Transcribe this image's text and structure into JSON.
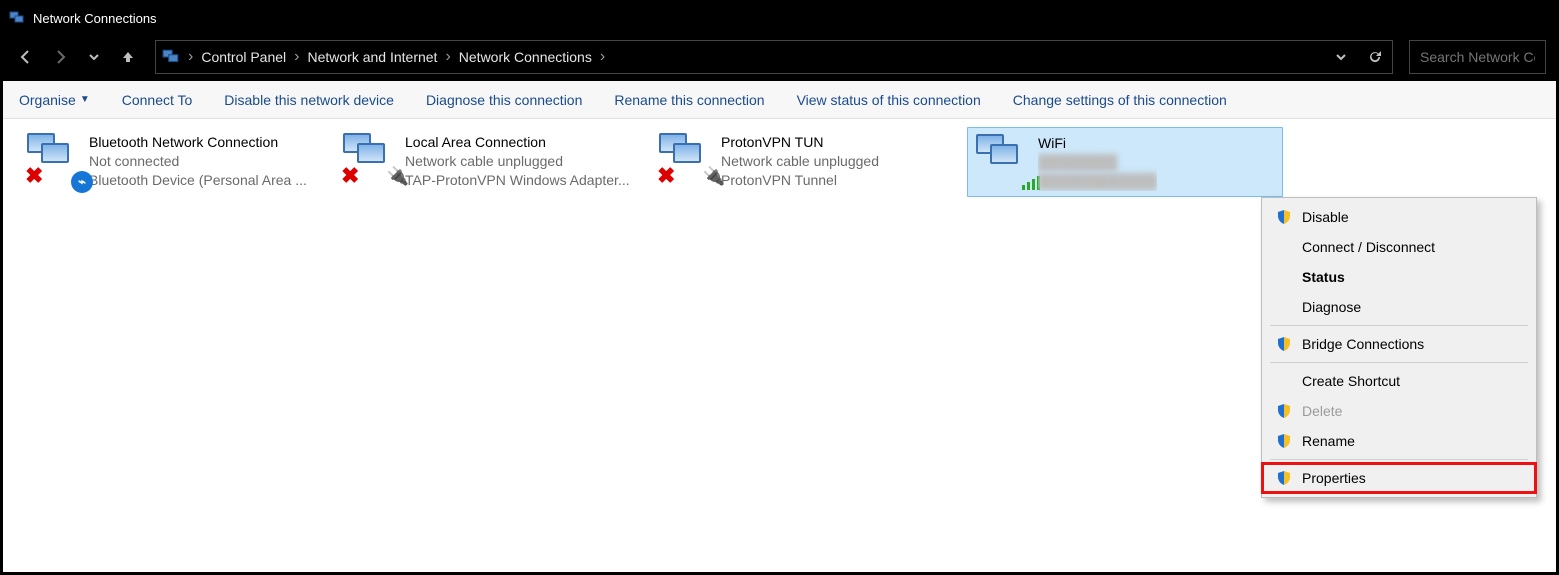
{
  "window": {
    "title": "Network Connections"
  },
  "breadcrumbs": {
    "items": [
      "Control Panel",
      "Network and Internet",
      "Network Connections"
    ]
  },
  "search": {
    "placeholder": "Search Network Conne"
  },
  "toolbar": {
    "organise": "Organise",
    "items": [
      "Connect To",
      "Disable this network device",
      "Diagnose this connection",
      "Rename this connection",
      "View status of this connection",
      "Change settings of this connection"
    ]
  },
  "connections": [
    {
      "name": "Bluetooth Network Connection",
      "status": "Not connected",
      "device": "Bluetooth Device (Personal Area ...",
      "overlay": "bluetooth-x",
      "selected": false
    },
    {
      "name": "Local Area Connection",
      "status": "Network cable unplugged",
      "device": "TAP-ProtonVPN Windows Adapter...",
      "overlay": "plug-x",
      "selected": false
    },
    {
      "name": "ProtonVPN TUN",
      "status": "Network cable unplugged",
      "device": "ProtonVPN Tunnel",
      "overlay": "plug-x",
      "selected": false
    },
    {
      "name": "WiFi",
      "status": "████████",
      "device": "████████████",
      "overlay": "wifi-bars",
      "selected": true
    }
  ],
  "context_menu": {
    "items": [
      {
        "label": "Disable",
        "shield": true,
        "bold": false,
        "disabled": false,
        "highlight": false
      },
      {
        "label": "Connect / Disconnect",
        "shield": false,
        "bold": false,
        "disabled": false,
        "highlight": false
      },
      {
        "label": "Status",
        "shield": false,
        "bold": true,
        "disabled": false,
        "highlight": false
      },
      {
        "label": "Diagnose",
        "shield": false,
        "bold": false,
        "disabled": false,
        "highlight": false
      },
      {
        "sep": true
      },
      {
        "label": "Bridge Connections",
        "shield": true,
        "bold": false,
        "disabled": false,
        "highlight": false
      },
      {
        "sep": true
      },
      {
        "label": "Create Shortcut",
        "shield": false,
        "bold": false,
        "disabled": false,
        "highlight": false
      },
      {
        "label": "Delete",
        "shield": true,
        "bold": false,
        "disabled": true,
        "highlight": false
      },
      {
        "label": "Rename",
        "shield": true,
        "bold": false,
        "disabled": false,
        "highlight": false
      },
      {
        "sep": true
      },
      {
        "label": "Properties",
        "shield": true,
        "bold": false,
        "disabled": false,
        "highlight": true
      }
    ]
  }
}
